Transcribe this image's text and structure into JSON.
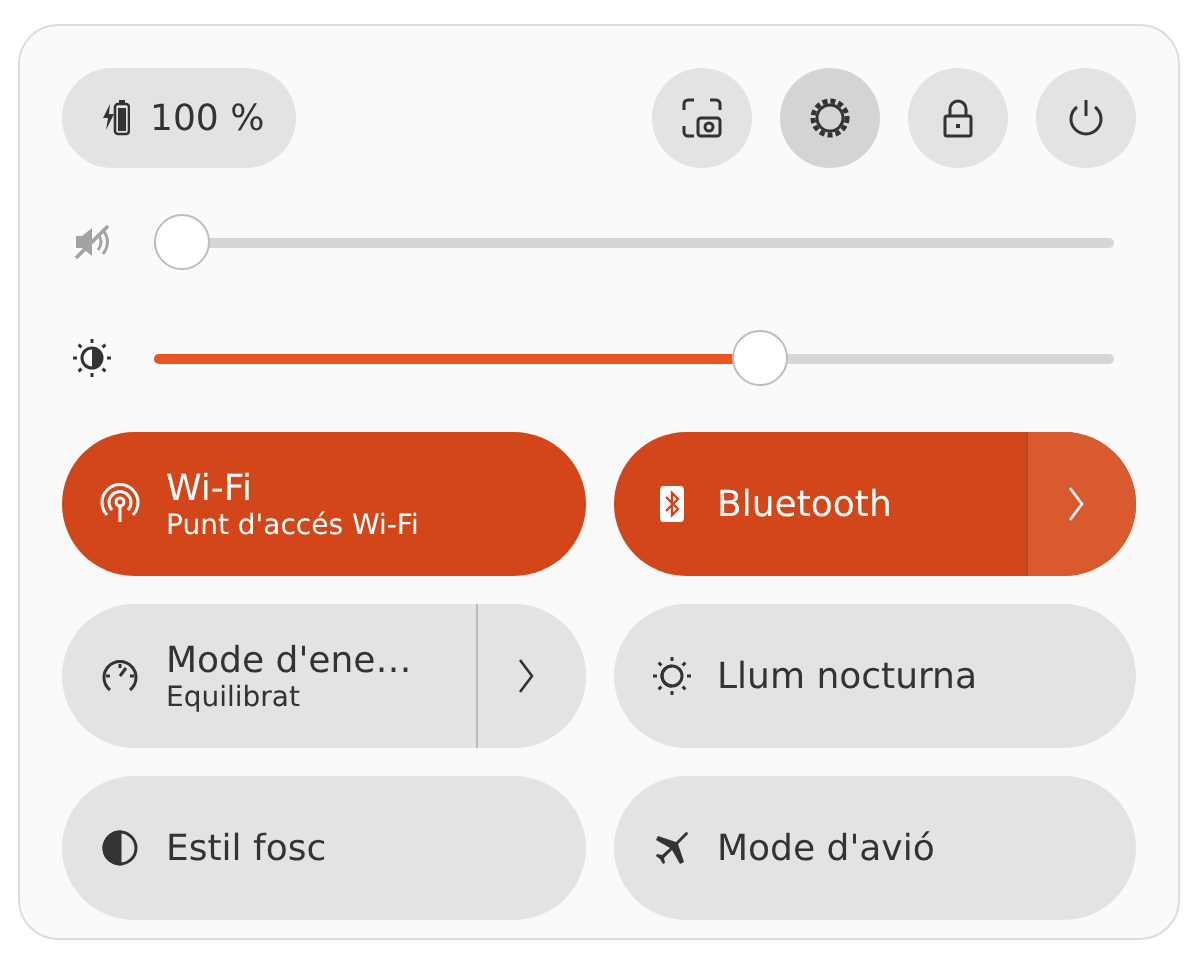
{
  "battery": {
    "label": "100 %"
  },
  "system_buttons": [
    {
      "pressed": false
    },
    {
      "pressed": true
    },
    {
      "pressed": false
    },
    {
      "pressed": false
    }
  ],
  "sliders": [
    {
      "muted": true,
      "level": 0
    },
    {
      "level": 0.64
    }
  ],
  "toggles": [
    {
      "title": "Wi-Fi",
      "subtitle": "Punt d'accés Wi-Fi",
      "on": true,
      "has_menu": false
    },
    {
      "title": "Bluetooth",
      "on": true,
      "has_menu": true
    },
    {
      "title": "Mode d'ene…",
      "subtitle": "Equilibrat",
      "on": false,
      "has_menu": true
    },
    {
      "title": "Llum nocturna",
      "on": false,
      "has_menu": false
    },
    {
      "title": "Estil fosc",
      "on": false,
      "has_menu": false
    },
    {
      "title": "Mode d'avió",
      "on": false,
      "has_menu": false
    }
  ]
}
